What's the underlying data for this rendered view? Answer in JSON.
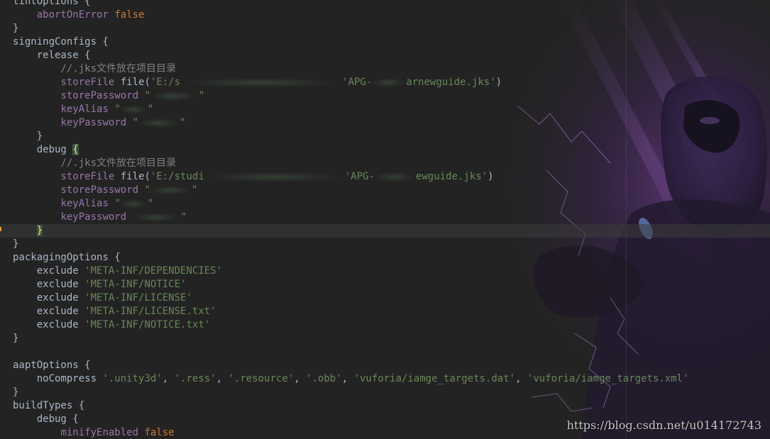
{
  "editor": {
    "language": "gradle",
    "colors": {
      "background": "#232323",
      "keyword": "#cc7832",
      "string": "#6a8759",
      "method": "#ffc66d",
      "property": "#9876aa",
      "comment": "#808080",
      "text": "#a9b7c6"
    }
  },
  "code": {
    "l1_a": "lintOptions {",
    "l2_prop": "abortOnError",
    "l2_val": "false",
    "l3": "}",
    "l4": "signingConfigs {",
    "l5": "release {",
    "l6_cmt": "//.jks文件放在项目目录",
    "l7_prop": "storeFile",
    "l7_fn": "file",
    "l7_open": "(",
    "l7_s1": "'E:/s",
    "l7_s2": "'APG-",
    "l7_s3": "arnewguide.jks'",
    "l7_close": ")",
    "l8_prop": "storePassword",
    "l8_s1": "\"",
    "l8_s2": "\"",
    "l9_prop": "keyAlias",
    "l9_s1": "\"",
    "l9_s2": "\"",
    "l10_prop": "keyPassword",
    "l10_s1": "\"",
    "l10_s2": "\"",
    "l11": "}",
    "l12_a": "debug ",
    "l12_b": "{",
    "l13_cmt": "//.jks文件放在项目目录",
    "l14_prop": "storeFile",
    "l14_fn": "file",
    "l14_open": "(",
    "l14_s1": "'E:/studi",
    "l14_s2": "'APG-",
    "l14_s3": "ewguide.jks'",
    "l14_close": ")",
    "l15_prop": "storePassword",
    "l15_s1": "\"",
    "l15_s2": "\"",
    "l16_prop": "keyAlias",
    "l16_s1": "\"",
    "l16_s2": "\"",
    "l17_prop": "keyPassword",
    "l17_s1": "",
    "l17_s2": "\"",
    "l18": "}",
    "l19": "}",
    "l20": "packagingOptions {",
    "l21_kw": "exclude",
    "l21_s": "'META-INF/DEPENDENCIES'",
    "l22_kw": "exclude",
    "l22_s": "'META-INF/NOTICE'",
    "l23_kw": "exclude",
    "l23_s": "'META-INF/LICENSE'",
    "l24_kw": "exclude",
    "l24_s": "'META-INF/LICENSE.txt'",
    "l25_kw": "exclude",
    "l25_s": "'META-INF/NOTICE.txt'",
    "l26": "}",
    "l27": "",
    "l28": "aaptOptions {",
    "l29_kw": "noCompress",
    "l29_s1": "'.unity3d'",
    "l29_s2": "'.ress'",
    "l29_s3": "'.resource'",
    "l29_s4": "'.obb'",
    "l29_s5": "'vuforia/iamge_targets.dat'",
    "l29_s6": "'vuforia/iamge_targets.xml'",
    "l30": "}",
    "l31": "buildTypes {",
    "l32": "debug {",
    "l33_prop": "minifyEnabled",
    "l33_val": "false"
  },
  "watermark": "https://blog.csdn.net/u014172743"
}
